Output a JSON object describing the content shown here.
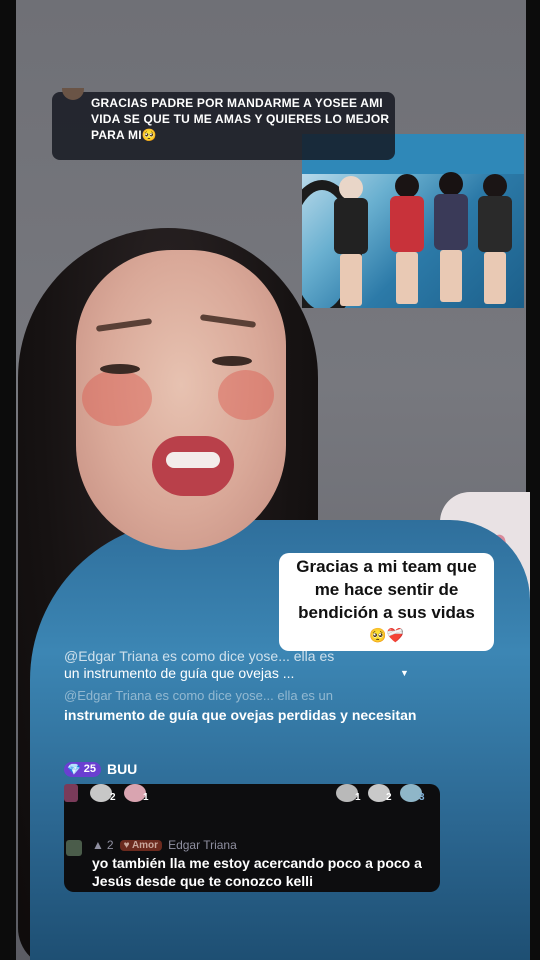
{
  "top_banner": {
    "message": "GRACIAS PADRE POR MANDARME A YOSEE AMI VIDA SE QUE TU ME AMAS Y QUIERES LO MEJOR PARA MI🥺"
  },
  "caption": {
    "line1": "Gracias a mi team que",
    "line2": "me hace sentir de",
    "line3": "bendición a sus vidas",
    "emoji": "🥺❤️‍🩹"
  },
  "comments": [
    {
      "text_line1": "@Edgar Triana es como dice yose... ella es",
      "text_line2": "un instrumento de guía que ovejas ..."
    },
    {
      "faded_header": "@Edgar Triana es como dice yose... ella es un",
      "text": "instrumento de guía que ovejas perdidas y necesitan"
    }
  ],
  "gift_row": {
    "badge_level": "25",
    "user": "BUU"
  },
  "viewer_counts": [
    "2",
    "1",
    "1",
    "2",
    "3"
  ],
  "last_comment": {
    "level": "2",
    "badge": "Amor",
    "username": "Edgar Triana",
    "text": "yo también lla me estoy acercando poco a poco a Jesús desde que te conozco kelli"
  }
}
